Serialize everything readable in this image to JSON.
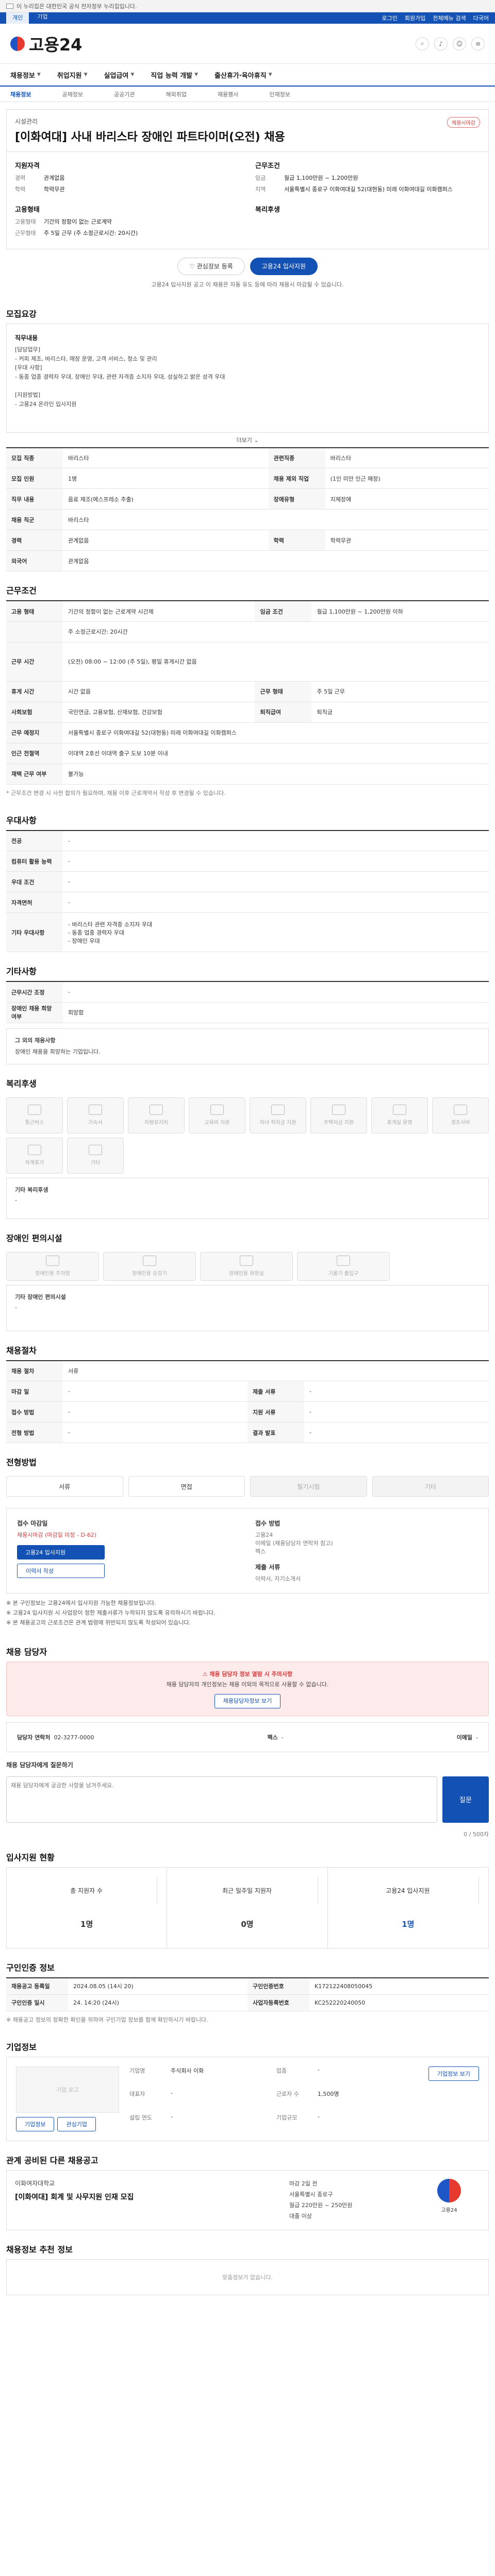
{
  "gov_strip": {
    "text": "이 누리집은 대한민국 공식 전자정부 누리집입니다."
  },
  "topbar": {
    "tabs": [
      "개인",
      "기업"
    ],
    "right": [
      "로그인",
      "회원가입",
      "전체메뉴 검색",
      "다국어"
    ]
  },
  "header": {
    "logo": "고용24",
    "icons": [
      "search-icon",
      "bell-icon",
      "user-icon",
      "menu-icon"
    ]
  },
  "gnb": [
    "채용정보",
    "취업지원",
    "실업급여",
    "직업 능력 개발",
    "출산휴가·육아휴직"
  ],
  "subnav": [
    "채용정보",
    "공채정보",
    "공공기관",
    "해외취업",
    "채용행사",
    "인재정보"
  ],
  "job": {
    "company": "시설관리",
    "title": "[이화여대] 사내 바리스타 장애인 파트타이머(오전) 채용",
    "badge": "채용시마감",
    "summary_left_title": "지원자격",
    "left": [
      {
        "k": "경력",
        "v": "관계없음"
      },
      {
        "k": "학력",
        "v": "학력무관"
      }
    ],
    "right_title": "근무조건",
    "right": [
      {
        "k": "임금",
        "v": "월급 1,100만원 ~ 1,200만원"
      },
      {
        "k": "지역",
        "v": "서울특별시 종로구 이화여대길 52(대현동) 미래 이화여대길 이화캠퍼스"
      }
    ],
    "left2_title": "고용형태",
    "left2": [
      {
        "k": "고용형태",
        "v": "기간의 정함이 없는 근로계약"
      },
      {
        "k": "근무형태",
        "v": "주 5일 근무 (주 소정근로시간: 20시간)"
      }
    ],
    "right2_title": "복리후생",
    "btn_scrap": "관심정보 등록",
    "btn_apply": "고용24 입사지원",
    "note": "고용24 입사지원 공고 이 채용은 자동 유도 등에 따라 채용시 마감될 수 있습니다."
  },
  "recruit": {
    "title": "모집요강",
    "detail_head": "직무내용",
    "detail_lines": [
      "[담당업무]",
      "- 커피 제조, 바리스타, 매장 운영, 고객 서비스, 청소 및 관리",
      "",
      "[우대 사항]",
      "- 동종 업종 경력자 우대, 장애인 우대, 관련 자격증 소지자 우대, 성실하고 밝은 성격 우대",
      "",
      "[지원방법]",
      "- 고용24 온라인 입사지원"
    ],
    "more": "더보기",
    "rows": [
      {
        "k": "모집 직종",
        "v": "바리스타",
        "k2": "관련직종",
        "v2": "바리스타"
      },
      {
        "k": "모집 인원",
        "v": "1명",
        "k2": "채용 제외 직업",
        "v2": "(1인 미만 인근 매장)"
      },
      {
        "k": "직무 내용",
        "v": "음료 제조(에스프레소 추출)",
        "k2": "장애유형",
        "v2": "지체장애"
      },
      {
        "k": "채용 직군",
        "v": "바리스타",
        "k2": "",
        "v2": ""
      },
      {
        "k": "경력",
        "v": "관계없음",
        "k2": "학력",
        "v2": "학력무관"
      },
      {
        "k": "외국어",
        "v": "관계없음",
        "k2": "",
        "v2": ""
      }
    ]
  },
  "work": {
    "title": "근무조건",
    "rows": [
      {
        "k": "고용 형태",
        "v": "기간의 정함이 없는 근로계약 시간제",
        "k2": "임금 조건",
        "v2": "월급 1,100만원 ~ 1,200만원 이하"
      },
      {
        "k": "",
        "v": "주 소정근로시간: 20시간",
        "k2": "",
        "v2": ""
      },
      {
        "k": "근무 시간",
        "v": "(오전) 08:00 ~ 12:00 (주 5일), 평일 휴게시간 없음",
        "k2": "",
        "v2": ""
      },
      {
        "k": "휴게 시간",
        "v": "시간 없음",
        "k2": "근무 형태",
        "v2": "주 5일 근무"
      },
      {
        "k": "사회보험",
        "v": "국민연금, 고용보험, 산재보험, 건강보험",
        "k2": "퇴직급여",
        "v2": "퇴직금"
      },
      {
        "k": "근무 예정지",
        "v": "서울특별시 종로구 이화여대길 52(대현동) 미래 이화여대길 이화캠퍼스",
        "k2": "",
        "v2": ""
      },
      {
        "k": "인근 전철역",
        "v": "이대역 2호선 이대역 출구 도보 10분 이내",
        "k2": "",
        "v2": ""
      },
      {
        "k": "재택 근무 여부",
        "v": "불가능",
        "k2": "",
        "v2": ""
      }
    ],
    "footnote": "* 근무조건 변경 시 사전 합의가 필요하며, 채용 이후 근로계약서 작성 후 변경될 수 있습니다."
  },
  "pref": {
    "title": "우대사항",
    "rows": [
      {
        "k": "전공",
        "v": "-"
      },
      {
        "k": "컴퓨터 활용 능력",
        "v": "-"
      },
      {
        "k": "우대 조건",
        "v": "-"
      },
      {
        "k": "자격면허",
        "v": "-"
      },
      {
        "k": "기타 우대사항",
        "v": "- 바리스타 관련 자격증 소지자 우대\n- 동종 업종 경력자 우대\n- 장애인 우대"
      }
    ]
  },
  "etc": {
    "title": "기타사항",
    "rows": [
      {
        "k": "근무시간 조정",
        "v": "-"
      },
      {
        "k": "장애인 채용 희망 여부",
        "v": "희망함"
      }
    ],
    "extra_head": "그 외의 채용사항",
    "extra_text": "장애인 채용을 희망하는 기업입니다."
  },
  "welfare": {
    "title": "복리후생",
    "icons": [
      "통근버스",
      "기숙사",
      "차량유지비",
      "교육비 지원",
      "자녀 학자금 지원",
      "주택자금 지원",
      "휴게실 운영",
      "경조사비",
      "하계휴가",
      "기타"
    ],
    "box_head": "기타 복리후생",
    "box_text": "-"
  },
  "disab": {
    "title": "장애인 편의시설",
    "icons": [
      "장애인용 주차장",
      "장애인용 승강기",
      "장애인용 화장실",
      "기울기 출입구"
    ],
    "box_head": "기타 장애인 편의시설",
    "box_text": "-"
  },
  "process": {
    "title": "채용절차",
    "rows": [
      {
        "k": "채용 절차",
        "v": "서류",
        "k2": "",
        "v2": ""
      },
      {
        "k": "마감 일",
        "v": "-",
        "k2": "제출 서류",
        "v2": "-"
      },
      {
        "k": "접수 방법",
        "v": "-",
        "k2": "지원 서류",
        "v2": "-"
      },
      {
        "k": "전형 방법",
        "v": "-",
        "k2": "결과 발표",
        "v2": "-"
      }
    ]
  },
  "apply": {
    "title": "전형방법",
    "btns": [
      "서류",
      "면접",
      "필기시험",
      "기타"
    ],
    "left_title": "접수 마감일",
    "deadline": "채용시마감 (마감일 미정 - D-62)",
    "apply_btn": "고용24 입사지원",
    "scrap_btn": "이력서 작성",
    "right_title": "접수 방법",
    "right_lines": [
      "고용24",
      "이메일 (채용담당자 연락처 참고)",
      "팩스"
    ],
    "docs_title": "제출 서류",
    "docs": "이력서, 자기소개서"
  },
  "notice": [
    "※ 본 구인정보는 고용24에서 입사지원 가능한 채용정보입니다.",
    "※ 고용24 입사지원 시 사업장이 정한 제출서류가 누락되지 않도록 유의하시기 바랍니다.",
    "※ 본 채용공고의 근로조건은 관계 법령에 위반되지 않도록 작성되어 있습니다."
  ],
  "contact": {
    "title": "채용 담당자",
    "warn_title": "채용 담당자 정보 열람 시 주의사항",
    "warn": "채용 담당자의 개인정보는 채용 이외의 목적으로 사용할 수 없습니다.",
    "warn_btn": "채용담당자정보 보기",
    "phone_label": "담당자 연락처",
    "phone": "02-3277-0000",
    "fax_label": "팩스",
    "fax": "-",
    "email_label": "이메일",
    "email": "-"
  },
  "qa": {
    "label": "채용 담당자에게 질문하기",
    "placeholder": "채용 담당자에게 궁금한 사항을 남겨주세요.",
    "count": "0 / 500자",
    "btn": "질문"
  },
  "stats": {
    "title": "입사지원 현황",
    "items": [
      {
        "n": "총 지원자 수",
        "v": "1명"
      },
      {
        "n": "최근 일주일 지원자",
        "v": "0명"
      },
      {
        "n": "고용24 입사지원",
        "v": "1명"
      }
    ]
  },
  "org": {
    "title": "구인인증 정보",
    "rows": [
      {
        "k": "채용공고 등록일",
        "v": "2024.08.05 (14시 20)",
        "k2": "구인인증번호",
        "v2": "K172122408050045"
      },
      {
        "k": "구인인증 일시",
        "v": "24. 14:20 (24시)",
        "k2": "사업자등록번호",
        "v2": "KC252220240050"
      }
    ],
    "footnote": "※ 채용공고 정보의 정확한 확인을 위하여 구인기업 정보를 함께 확인하시기 바랍니다."
  },
  "biz": {
    "title": "기업정보",
    "logo": "기업 로고",
    "btns": [
      "기업정보",
      "관심기업"
    ],
    "rows": [
      {
        "k": "기업명",
        "v": "주식회사 이화"
      },
      {
        "k": "업종",
        "v": "-"
      },
      {
        "k": "대표자",
        "v": "-"
      },
      {
        "k": "근로자 수",
        "v": "1,500명"
      },
      {
        "k": "설립 연도",
        "v": "-"
      },
      {
        "k": "기업규모",
        "v": "-"
      }
    ],
    "link": "기업정보 보기"
  },
  "rec": {
    "title": "관계 공비된 다른 채용공고",
    "company": "이화여자대학교",
    "job": "[이화여대] 회계 및 사무지원 인재 모집",
    "lines": [
      "마감 2일 전",
      "서울특별시 종로구",
      "월급 220만원 ~ 250만원",
      "대졸 이상"
    ],
    "label": "고용24"
  },
  "empty": {
    "title": "채용정보 추천 정보",
    "text": "맞춤정보가 없습니다."
  }
}
